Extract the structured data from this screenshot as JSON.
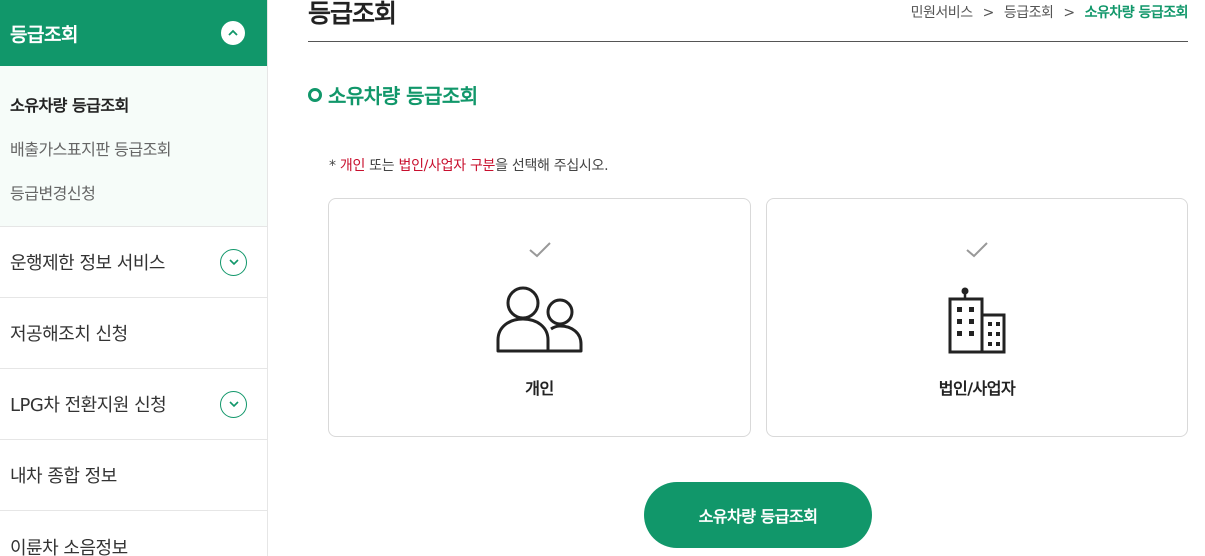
{
  "sidebar": {
    "header": {
      "title": "등급조회",
      "icon": "chevron-up-icon"
    },
    "sub_items": [
      {
        "label": "소유차량 등급조회",
        "active": true
      },
      {
        "label": "배출가스표지판 등급조회",
        "active": false
      },
      {
        "label": "등급변경신청",
        "active": false
      }
    ],
    "items": [
      {
        "label": "운행제한 정보 서비스",
        "expandable": true
      },
      {
        "label": "저공해조치 신청",
        "expandable": false
      },
      {
        "label": "LPG차 전환지원 신청",
        "expandable": true
      },
      {
        "label": "내차 종합 정보",
        "expandable": false
      },
      {
        "label": "이륜차 소음정보",
        "expandable": false
      }
    ]
  },
  "header": {
    "title": "등급조회",
    "breadcrumb": [
      "민원서비스",
      "등급조회",
      "소유차량 등급조회"
    ],
    "separator": ">"
  },
  "section": {
    "title": "소유차량 등급조회"
  },
  "notice": {
    "prefix": "* ",
    "term1": "개인",
    "mid": " 또는 ",
    "term2": "법인/사업자 구분",
    "suffix": "을 선택해 주십시오."
  },
  "options": [
    {
      "label": "개인",
      "icon": "people-icon"
    },
    {
      "label": "법인/사업자",
      "icon": "building-icon"
    }
  ],
  "submit_label": "소유차량 등급조회",
  "colors": {
    "accent": "#11976a",
    "highlight": "#c8102e",
    "sub_menu_bg": "#f6fcf9"
  }
}
